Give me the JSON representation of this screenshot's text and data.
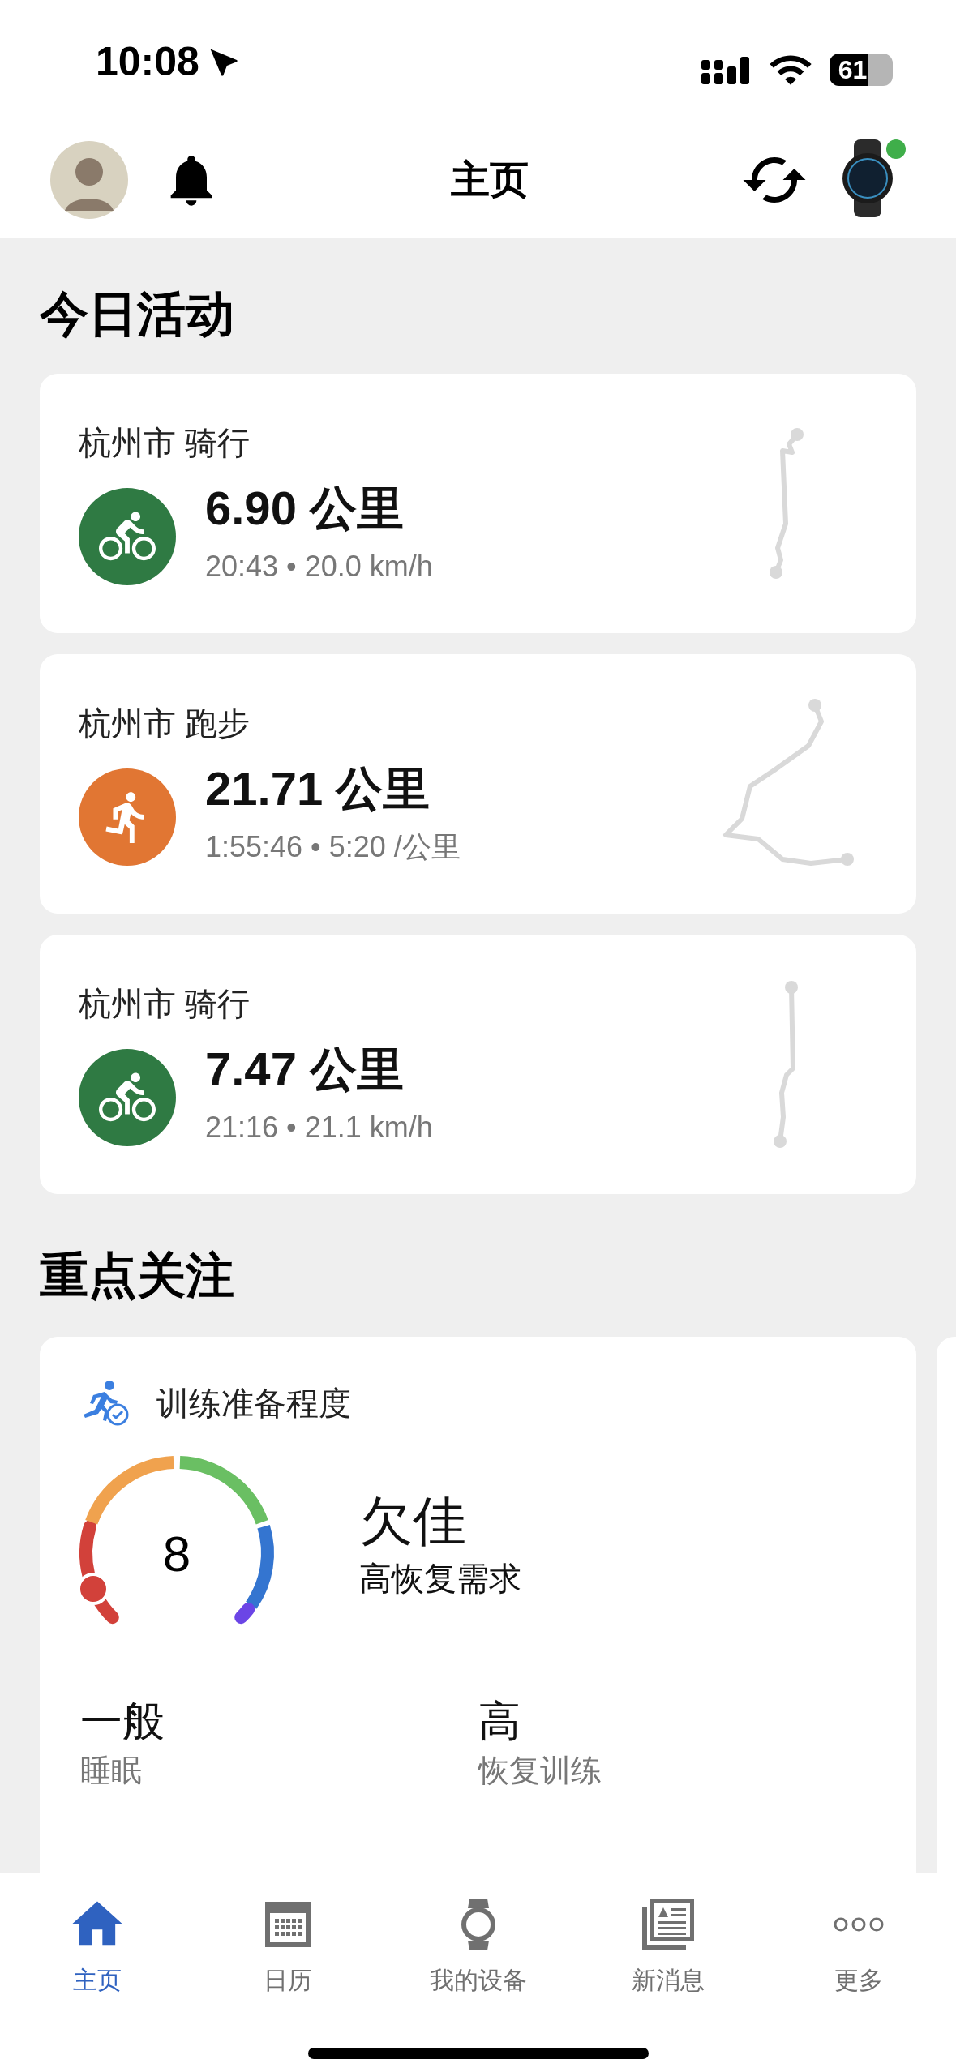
{
  "status_bar": {
    "time": "10:08",
    "battery": "61"
  },
  "header": {
    "title": "主页"
  },
  "today": {
    "title": "今日活动",
    "activities": [
      {
        "kind": "cycling",
        "title": "杭州市 骑行",
        "distance": "6.90 公里",
        "details": "20:43 • 20.0 km/h"
      },
      {
        "kind": "running",
        "title": "杭州市 跑步",
        "distance": "21.71 公里",
        "details": "1:55:46 • 5:20 /公里"
      },
      {
        "kind": "cycling",
        "title": "杭州市 骑行",
        "distance": "7.47 公里",
        "details": "21:16 • 21.1 km/h"
      }
    ]
  },
  "focus": {
    "title": "重点关注",
    "readiness": {
      "title": "训练准备程度",
      "score": "8",
      "status": "欠佳",
      "description": "高恢复需求",
      "factors": [
        {
          "value": "一般",
          "label": "睡眠"
        },
        {
          "value": "高",
          "label": "恢复训练"
        }
      ]
    }
  },
  "tab_bar": [
    {
      "kind": "home",
      "label": "主页",
      "selected": true
    },
    {
      "kind": "calendar",
      "label": "日历",
      "selected": false
    },
    {
      "kind": "device",
      "label": "我的设备",
      "selected": false
    },
    {
      "kind": "news",
      "label": "新消息",
      "selected": false
    },
    {
      "kind": "more",
      "label": "更多",
      "selected": false
    }
  ]
}
